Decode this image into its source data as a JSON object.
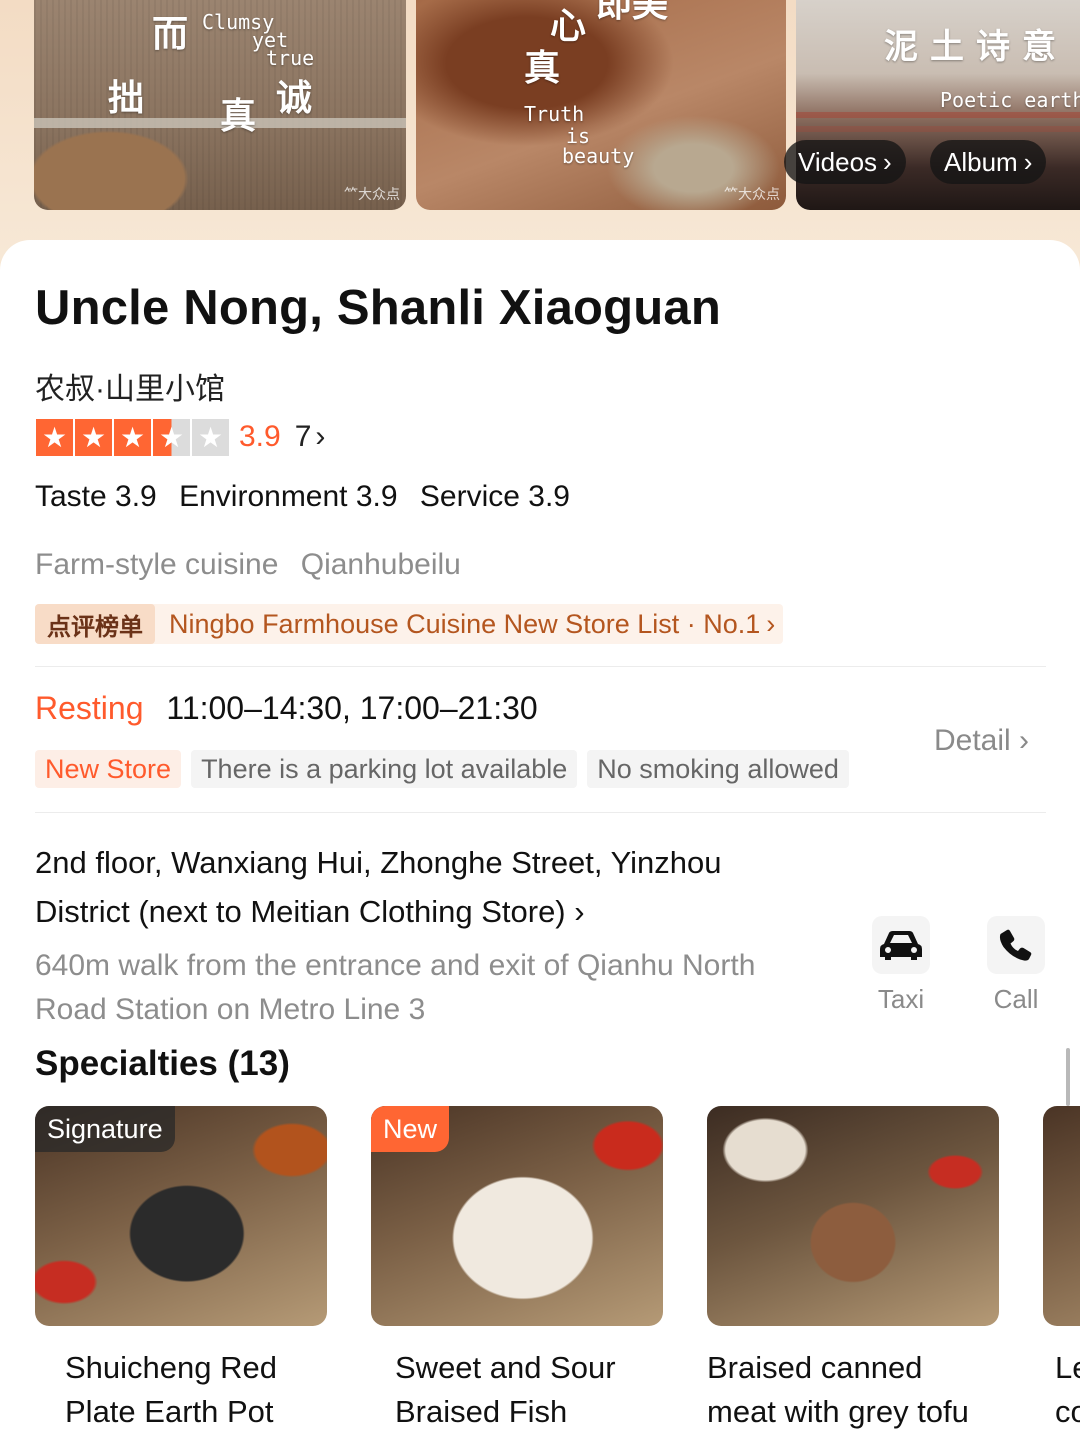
{
  "gallery": {
    "photo1": {
      "zh": [
        "而",
        "拙",
        "真",
        "诚"
      ],
      "en": [
        "Clumsy",
        "yet",
        "true"
      ],
      "watermark": "⺮大众点"
    },
    "photo2": {
      "zh": [
        "心",
        "真",
        "即美"
      ],
      "en": [
        "Truth",
        "is",
        "beauty"
      ],
      "watermark": "⺮大众点"
    },
    "photo3": {
      "zh": "泥土诗意",
      "en": "Poetic earth"
    },
    "videos_label": "Videos",
    "album_label": "Album"
  },
  "shop": {
    "name_en": "Uncle Nong, Shanli Xiaoguan",
    "name_zh": "农叔·山里小馆",
    "rating_stars": 3.5,
    "score": "3.9",
    "review_count": "7",
    "subscores": [
      "Taste 3.9",
      "Environment 3.9",
      "Service 3.9"
    ],
    "category": "Farm-style cuisine",
    "area": "Qianhubeilu",
    "rank_badge": "点评榜单",
    "rank_text": "Ningbo Farmhouse Cuisine New Store List · No.1"
  },
  "hours": {
    "status": "Resting",
    "times": "11:00–14:30, 17:00–21:30",
    "tags": [
      "New Store",
      "There is a parking lot available",
      "No smoking allowed"
    ],
    "detail_label": "Detail"
  },
  "location": {
    "address": "2nd floor, Wanxiang Hui, Zhonghe Street, Yinzhou District (next to Meitian Clothing Store)",
    "metro": "640m walk from the entrance and exit of Qianhu North Road Station on Metro Line 3",
    "taxi_label": "Taxi",
    "call_label": "Call"
  },
  "specialties": {
    "title": "Specialties (13)",
    "dishes": [
      {
        "badge": "Signature",
        "name": "Shuicheng Red Plate Earth Pot"
      },
      {
        "badge": "New",
        "name": "Sweet and Sour Braised Fish"
      },
      {
        "badge": "",
        "name": "Braised canned meat with grey tofu"
      },
      {
        "badge": "",
        "name": "Le co"
      }
    ]
  },
  "colors": {
    "accent": "#ff5a2c",
    "star": "#ff6633",
    "signature_badge": "#333333",
    "new_badge": "#ff6633"
  },
  "icons": [
    "car-icon",
    "phone-icon",
    "star-icon",
    "chevron-right-icon"
  ]
}
